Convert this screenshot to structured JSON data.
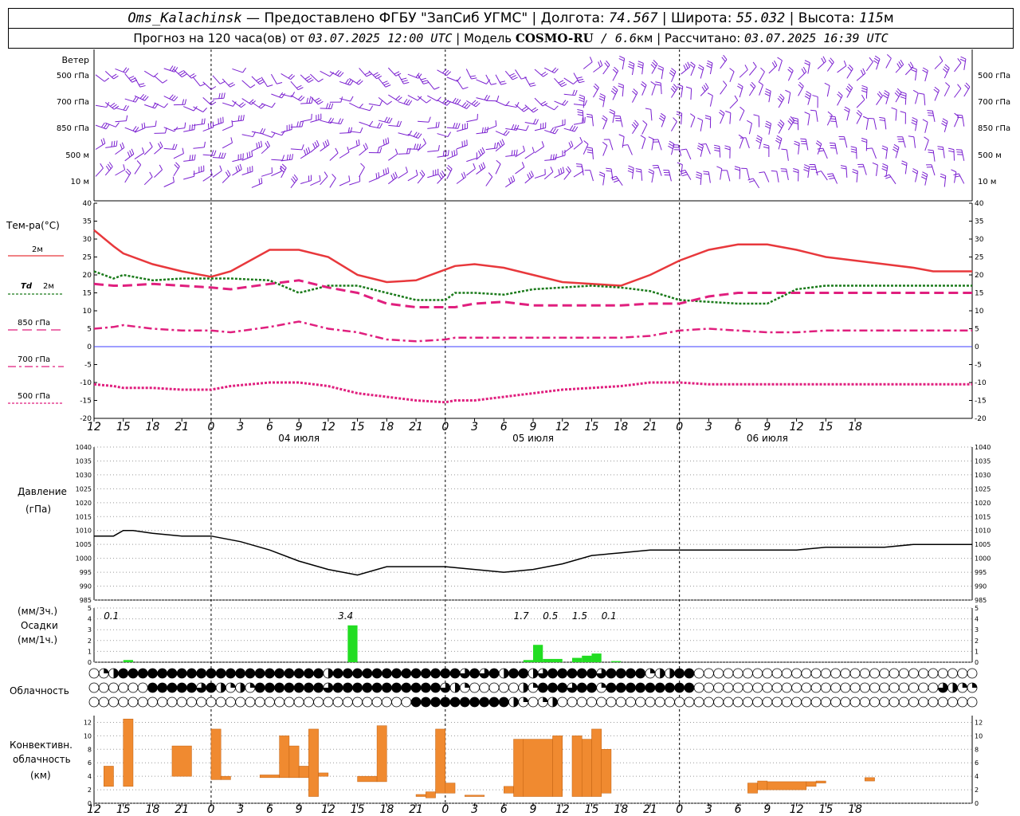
{
  "header": {
    "station": "Oms_Kalachinsk",
    "provided": " — Предоставлено ФГБУ \"ЗапСиб УГМС\" | Долгота: ",
    "lon": "74.567",
    "lat_label": " | Широта: ",
    "lat": "55.032",
    "alt_label": " | Высота: ",
    "alt": "115",
    "alt_unit": "м",
    "forecast_prefix": "Прогноз на 120 часа(ов) от ",
    "forecast_from": "03.07.2025 12:00 UTC",
    "model_label": " | Модель ",
    "model": "COSMO-RU",
    "model_res": " / 6.6",
    "model_res_unit": "км",
    "calc_label": " | Рассчитано: ",
    "calc_time": "03.07.2025 16:39 UTC"
  },
  "labels": {
    "wind": "Ветер",
    "levels": [
      "500 гПа",
      "700 гПа",
      "850 гПа",
      "500 м",
      "10 м"
    ],
    "temp": "Тем-ра(°С)",
    "t2m": "2м",
    "td": "Td",
    "td2": "2м",
    "l850": "850 гПа",
    "l700": "700 гПа",
    "l500": "500 гПа",
    "pressure": "Давление",
    "pressure_unit": "(гПа)",
    "precip_unit3": "(мм/3ч.)",
    "precip": "Осадки",
    "precip_unit1": "(мм/1ч.)",
    "cloud": "Облачность",
    "conv1": "Конвективн.",
    "conv2": "облачность",
    "conv3": "(км)"
  },
  "colors": {
    "t2m": "#e8383c",
    "td": "#1a7a1a",
    "t850": "#e01f7e",
    "t700": "#e01f7e",
    "t500": "#e01f7e",
    "wind": "#7a1fd0",
    "zero": "#3d3dff",
    "precip": "#22dd22",
    "conv": "#f08a30"
  },
  "chart_data": {
    "type": "meteogram",
    "time_labels": [
      "12",
      "15",
      "18",
      "21",
      "0",
      "3",
      "6",
      "9",
      "12",
      "15",
      "18",
      "21",
      "0",
      "3",
      "6",
      "9",
      "12",
      "15",
      "18",
      "21",
      "0",
      "3",
      "6",
      "9",
      "12",
      "15",
      "18"
    ],
    "day_labels": [
      {
        "label": "04 июля",
        "hour": 21
      },
      {
        "label": "05 июля",
        "hour": 45
      },
      {
        "label": "06 июля",
        "hour": 69
      }
    ],
    "temperature": {
      "ylim": [
        -20,
        40
      ],
      "yticks": [
        40,
        35,
        30,
        25,
        20,
        15,
        10,
        5,
        0,
        -5,
        -10,
        -15,
        -20
      ],
      "x": [
        0,
        2,
        3,
        6,
        9,
        12,
        14,
        18,
        21,
        24,
        27,
        30,
        33,
        36,
        37,
        39,
        42,
        45,
        48,
        51,
        54,
        57,
        60,
        63,
        66,
        69,
        72,
        75,
        78,
        81,
        84,
        86,
        87,
        90
      ],
      "t2m": [
        32.5,
        28,
        26,
        23,
        21,
        19.5,
        21,
        27,
        27,
        25,
        20,
        18,
        18.5,
        21.5,
        22.5,
        23,
        22,
        20,
        18,
        17.5,
        17,
        20,
        24,
        27,
        28.5,
        28.5,
        27,
        25,
        24,
        23,
        22,
        21,
        21,
        21
      ],
      "td": [
        21,
        19,
        20,
        18.5,
        19,
        19,
        19,
        18.5,
        15,
        17,
        17,
        15,
        13,
        13,
        15,
        15,
        14.5,
        16,
        16.5,
        17,
        16.5,
        15.5,
        13,
        12.5,
        12,
        12,
        16,
        17,
        17,
        17,
        17,
        17,
        17,
        17
      ],
      "t850": [
        17.5,
        17,
        17,
        17.5,
        17,
        16.5,
        16,
        17.5,
        18.5,
        16.5,
        15,
        12,
        11,
        11,
        11,
        12,
        12.5,
        11.5,
        11.5,
        11.5,
        11.5,
        12,
        12,
        14,
        15,
        15,
        15,
        15,
        15,
        15,
        15,
        15,
        15,
        15
      ],
      "t700": [
        5,
        5.5,
        6,
        5,
        4.5,
        4.5,
        4,
        5.5,
        7,
        5,
        4,
        2,
        1.5,
        2,
        2.5,
        2.5,
        2.5,
        2.5,
        2.5,
        2.5,
        2.5,
        3,
        4.5,
        5,
        4.5,
        4,
        4,
        4.5,
        4.5,
        4.5,
        4.5,
        4.5,
        4.5,
        4.5
      ],
      "t500": [
        -10.5,
        -11,
        -11.5,
        -11.5,
        -12,
        -12,
        -11,
        -10,
        -10,
        -11,
        -13,
        -14,
        -15,
        -15.5,
        -15,
        -15,
        -14,
        -13,
        -12,
        -11.5,
        -11,
        -10,
        -10,
        -10.5,
        -10.5,
        -10.5,
        -10.5,
        -10.5,
        -10.5,
        -10.5,
        -10.5,
        -10.5,
        -10.5,
        -10.5
      ]
    },
    "pressure": {
      "ylim": [
        985,
        1040
      ],
      "yticks": [
        1040,
        1035,
        1030,
        1025,
        1020,
        1015,
        1010,
        1005,
        1000,
        995,
        990,
        985
      ],
      "x": [
        0,
        2,
        3,
        4,
        6,
        9,
        12,
        15,
        18,
        21,
        24,
        27,
        30,
        33,
        36,
        39,
        42,
        45,
        48,
        51,
        54,
        57,
        60,
        63,
        66,
        69,
        72,
        75,
        78,
        81,
        84,
        87,
        90
      ],
      "values": [
        1008,
        1008,
        1010,
        1010,
        1009,
        1008,
        1008,
        1006,
        1003,
        999,
        996,
        994,
        997,
        997,
        997,
        996,
        995,
        996,
        998,
        1001,
        1002,
        1003,
        1003,
        1003,
        1003,
        1003,
        1003,
        1004,
        1004,
        1004,
        1005,
        1005,
        1005
      ]
    },
    "precipitation": {
      "ylim": [
        0,
        5
      ],
      "yticks": [
        5,
        4,
        3,
        2,
        1,
        0
      ],
      "bars": [
        {
          "hour": 3,
          "value": 0.2
        },
        {
          "hour": 26,
          "value": 3.4
        },
        {
          "hour": 44,
          "value": 0.2
        },
        {
          "hour": 45,
          "value": 1.6
        },
        {
          "hour": 46,
          "value": 0.3
        },
        {
          "hour": 47,
          "value": 0.3
        },
        {
          "hour": 49,
          "value": 0.4
        },
        {
          "hour": 50,
          "value": 0.6
        },
        {
          "hour": 51,
          "value": 0.8
        },
        {
          "hour": 53,
          "value": 0.1
        }
      ],
      "totals": [
        {
          "hour": 1,
          "label": "0.1"
        },
        {
          "hour": 25,
          "label": "3.4"
        },
        {
          "hour": 43,
          "label": "1.7"
        },
        {
          "hour": 46,
          "label": "0.5"
        },
        {
          "hour": 49,
          "label": "1.5"
        },
        {
          "hour": 52,
          "label": "0.1"
        }
      ]
    },
    "cloudiness": {
      "legend": "fraction 0-1 per hour: high, middle, low rows",
      "rows": [
        [
          0,
          0.25,
          0.5,
          1,
          1,
          1,
          1,
          1,
          1,
          1,
          1,
          1,
          1,
          1,
          1,
          1,
          1,
          1,
          1,
          1,
          1,
          1,
          1,
          1,
          0.5,
          1,
          1,
          1,
          1,
          1,
          1,
          1,
          1,
          1,
          1,
          1,
          1,
          1,
          0.75,
          1,
          0.75,
          1,
          0.5,
          1,
          1,
          0.5,
          0.75,
          1,
          1,
          1,
          1,
          1,
          0.75,
          1,
          1,
          1,
          1,
          0.25,
          0.5,
          0.5,
          1,
          1,
          0,
          0,
          0,
          0,
          0,
          0,
          0,
          0,
          0,
          0,
          0,
          0,
          0,
          0,
          0,
          0,
          0,
          0,
          0,
          0,
          0,
          0,
          0,
          0,
          0,
          0,
          0,
          0,
          0
        ],
        [
          0,
          0,
          0,
          0,
          0,
          0,
          1,
          1,
          1,
          1,
          1,
          0.75,
          1,
          0.5,
          0.25,
          0.5,
          0.25,
          1,
          1,
          1,
          1,
          1,
          1,
          1,
          0.75,
          1,
          1,
          1,
          1,
          1,
          1,
          1,
          1,
          1,
          1,
          1,
          0.75,
          0.5,
          0.25,
          0,
          0,
          0,
          0,
          0,
          0.5,
          0.25,
          1,
          1,
          1,
          0.75,
          1,
          1,
          0.25,
          1,
          1,
          1,
          1,
          1,
          1,
          1,
          1,
          1,
          0,
          0,
          0,
          0,
          0,
          0,
          0,
          0,
          0,
          0,
          0,
          0,
          0,
          0,
          0,
          0,
          0,
          0,
          0,
          0,
          0,
          0,
          0,
          0,
          0,
          0.75,
          0.5,
          0.25,
          0.25
        ],
        [
          0,
          0,
          0,
          0,
          0,
          0,
          0,
          0,
          0,
          0,
          0,
          0,
          0,
          0,
          0,
          0,
          0,
          0,
          0,
          0,
          0,
          0,
          0,
          0,
          0,
          0,
          0,
          0,
          0,
          0,
          0,
          0,
          0,
          1,
          1,
          1,
          1,
          1,
          1,
          1,
          1,
          1,
          1,
          0.5,
          0.25,
          0,
          0.25,
          0.5,
          0,
          0,
          0,
          0,
          0,
          0,
          0,
          0,
          0,
          0,
          0,
          0,
          0,
          0,
          0,
          0,
          0,
          0,
          0,
          0,
          0,
          0,
          0,
          0,
          0,
          0,
          0,
          0,
          0,
          0,
          0,
          0,
          0,
          0,
          0,
          0,
          0,
          0,
          0,
          0,
          0,
          0,
          0
        ]
      ]
    },
    "convective": {
      "ylim": [
        0,
        13
      ],
      "yticks": [
        12,
        10,
        8,
        6,
        4,
        2,
        0
      ],
      "bars": [
        {
          "h0": 1,
          "h1": 2,
          "bottom": 2.5,
          "top": 5.5
        },
        {
          "h0": 3,
          "h1": 4,
          "bottom": 2.5,
          "top": 12.5
        },
        {
          "h0": 8,
          "h1": 10,
          "bottom": 4,
          "top": 8.5
        },
        {
          "h0": 12,
          "h1": 13,
          "bottom": 3.5,
          "top": 11
        },
        {
          "h0": 13,
          "h1": 14,
          "bottom": 3.5,
          "top": 4
        },
        {
          "h0": 17,
          "h1": 19,
          "bottom": 3.8,
          "top": 4.2
        },
        {
          "h0": 19,
          "h1": 20,
          "bottom": 3.8,
          "top": 10
        },
        {
          "h0": 20,
          "h1": 21,
          "bottom": 3.8,
          "top": 8.5
        },
        {
          "h0": 21,
          "h1": 22,
          "bottom": 3.8,
          "top": 5.5
        },
        {
          "h0": 22,
          "h1": 23,
          "bottom": 1,
          "top": 11
        },
        {
          "h0": 23,
          "h1": 24,
          "bottom": 4,
          "top": 4.5
        },
        {
          "h0": 27,
          "h1": 29,
          "bottom": 3.2,
          "top": 4
        },
        {
          "h0": 29,
          "h1": 30,
          "bottom": 3.2,
          "top": 11.5
        },
        {
          "h0": 33,
          "h1": 34,
          "bottom": 1,
          "top": 1.3
        },
        {
          "h0": 34,
          "h1": 35,
          "bottom": 0.8,
          "top": 1.7
        },
        {
          "h0": 35,
          "h1": 36,
          "bottom": 1.5,
          "top": 11
        },
        {
          "h0": 36,
          "h1": 37,
          "bottom": 1.5,
          "top": 3
        },
        {
          "h0": 38,
          "h1": 40,
          "bottom": 1,
          "top": 1.2
        },
        {
          "h0": 42,
          "h1": 43,
          "bottom": 1.5,
          "top": 2.5
        },
        {
          "h0": 43,
          "h1": 44,
          "bottom": 1,
          "top": 9.5
        },
        {
          "h0": 44,
          "h1": 47,
          "bottom": 1,
          "top": 9.5
        },
        {
          "h0": 47,
          "h1": 48,
          "bottom": 1,
          "top": 10
        },
        {
          "h0": 49,
          "h1": 50,
          "bottom": 1,
          "top": 10
        },
        {
          "h0": 50,
          "h1": 51,
          "bottom": 1,
          "top": 9.5
        },
        {
          "h0": 51,
          "h1": 52,
          "bottom": 1,
          "top": 11
        },
        {
          "h0": 52,
          "h1": 53,
          "bottom": 1.5,
          "top": 8
        },
        {
          "h0": 67,
          "h1": 68,
          "bottom": 1.5,
          "top": 3
        },
        {
          "h0": 68,
          "h1": 69,
          "bottom": 2,
          "top": 3.3
        },
        {
          "h0": 69,
          "h1": 73,
          "bottom": 2,
          "top": 3.2
        },
        {
          "h0": 73,
          "h1": 74,
          "bottom": 2.5,
          "top": 3.2
        },
        {
          "h0": 74,
          "h1": 75,
          "bottom": 3,
          "top": 3.3
        },
        {
          "h0": 79,
          "h1": 80,
          "bottom": 3.3,
          "top": 3.8
        }
      ]
    }
  }
}
